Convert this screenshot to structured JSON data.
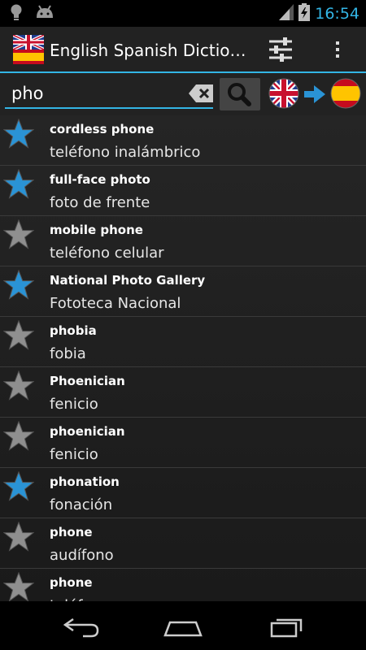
{
  "status_bar": {
    "time": "16:54",
    "icons": [
      "lightbulb-icon",
      "android-icon",
      "signal-icon",
      "battery-charging-icon"
    ]
  },
  "action_bar": {
    "title": "English Spanish Dictio…",
    "icons": [
      "uk-spain-flag-app-icon",
      "settings-sliders-icon",
      "overflow-menu-icon"
    ]
  },
  "search": {
    "query": "pho",
    "icons": [
      "clear-text-icon",
      "search-icon",
      "uk-flag-icon",
      "arrow-right-icon",
      "spain-flag-icon"
    ]
  },
  "colors": {
    "accent": "#33b5e5",
    "star_favorite": "#2a93d5",
    "star_default": "#8f8f8f"
  },
  "results": [
    {
      "term": "cordless phone",
      "translation": "teléfono inalámbrico",
      "starred": true
    },
    {
      "term": "full-face photo",
      "translation": "foto de frente",
      "starred": true
    },
    {
      "term": "mobile phone",
      "translation": "teléfono celular",
      "starred": false
    },
    {
      "term": "National Photo Gallery",
      "translation": "Fototeca Nacional",
      "starred": true
    },
    {
      "term": "phobia",
      "translation": "fobia",
      "starred": false
    },
    {
      "term": "Phoenician",
      "translation": "fenicio",
      "starred": false
    },
    {
      "term": "phoenician",
      "translation": "fenicio",
      "starred": false
    },
    {
      "term": "phonation",
      "translation": "fonación",
      "starred": true
    },
    {
      "term": "phone",
      "translation": "audífono",
      "starred": false
    },
    {
      "term": "phone",
      "translation": "teléfono",
      "starred": false
    }
  ],
  "nav_bar": {
    "icons": [
      "back-icon",
      "home-icon",
      "recent-apps-icon"
    ]
  }
}
